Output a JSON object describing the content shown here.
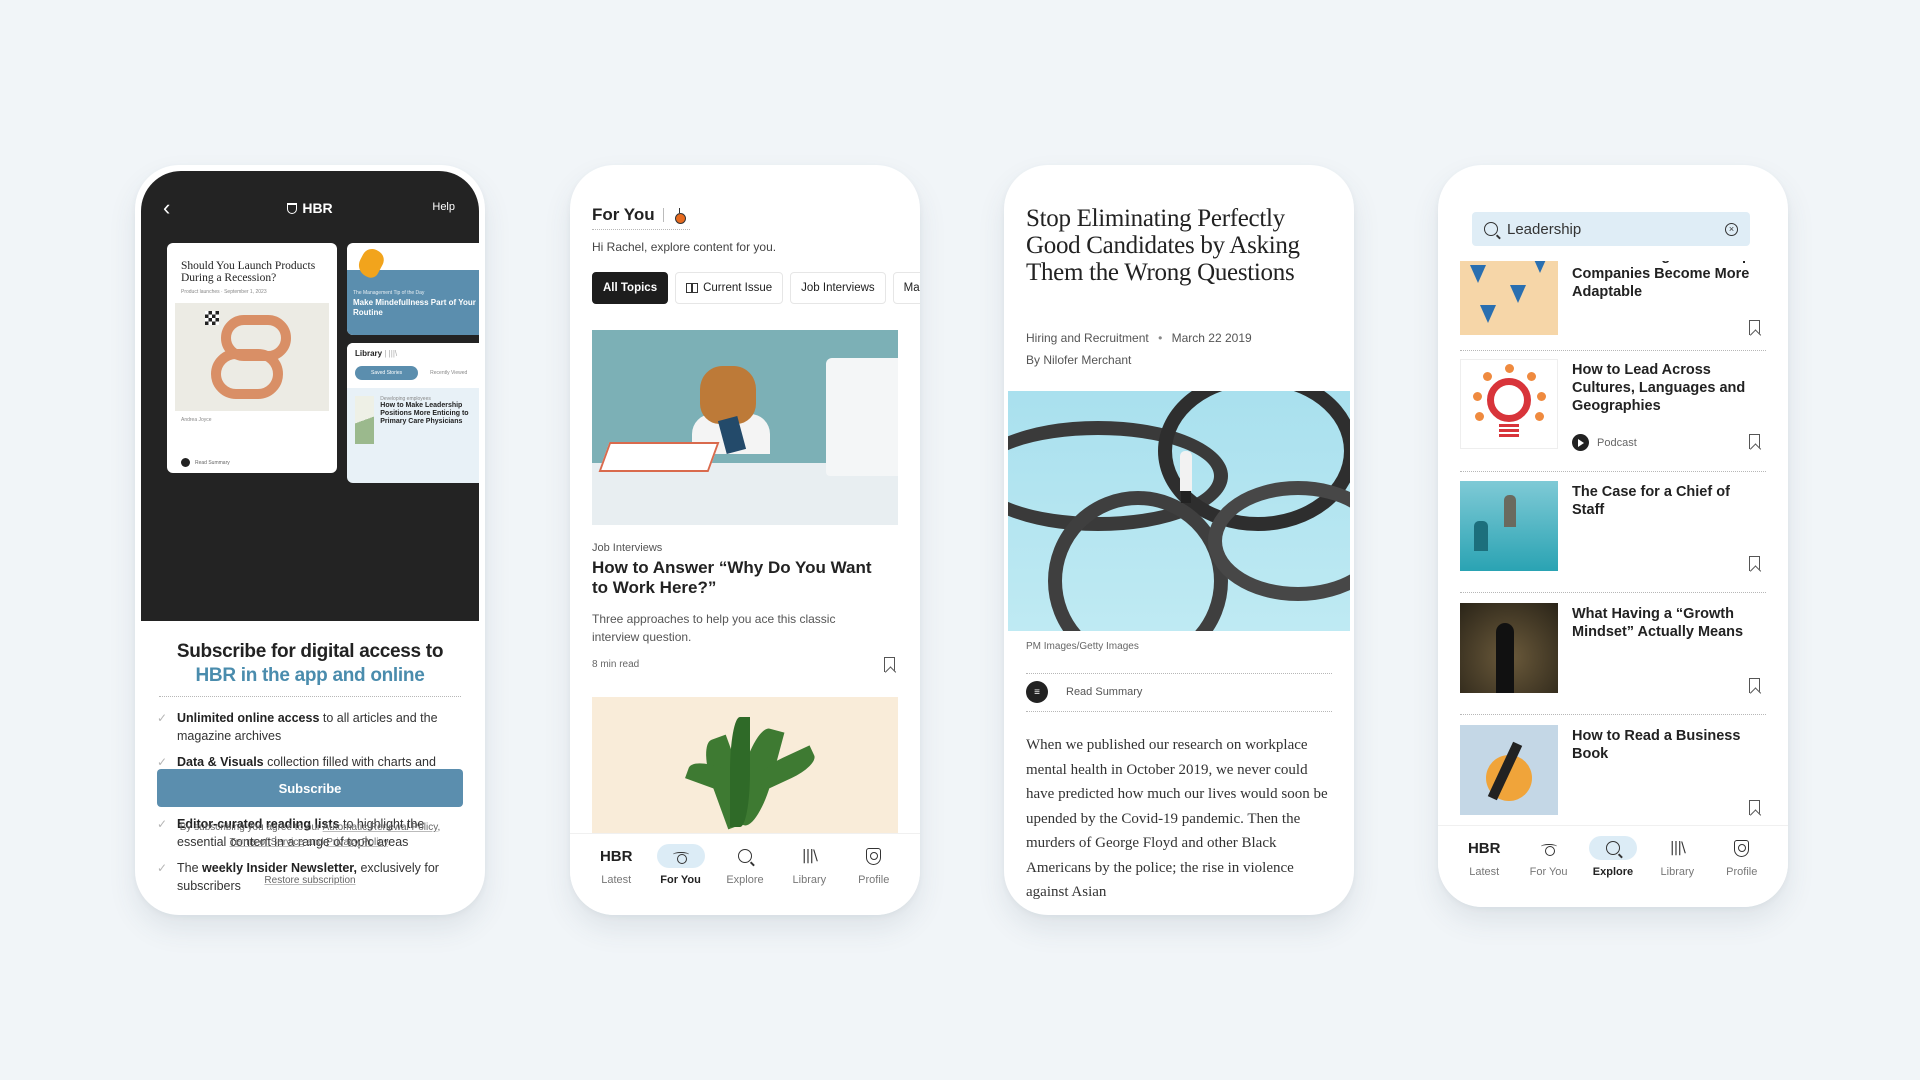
{
  "colors": {
    "background": "#f1f5f8",
    "accent": "#5b8eae",
    "accent_text": "#4a8cad",
    "dark": "#232323",
    "search_bg": "#dfedf6",
    "active_nav_bg": "#dcecf6"
  },
  "phones": [
    {
      "id": "subscribe-screen",
      "header": {
        "back_icon": "chevron-left-icon",
        "logo": "HBR",
        "help_label": "Help"
      },
      "preview": {
        "article": {
          "title": "Should You Launch Products During a Recession?",
          "meta": "Product launches · September 1, 2023",
          "credit": "Andrea Joyce",
          "read_summary": "Read Summary"
        },
        "tip": {
          "kicker": "The Management Tip of the Day",
          "title": "Make Mindefullness Part of Your Routine"
        },
        "library": {
          "title": "Library",
          "tabs": [
            "Saved Stories",
            "Recently Viewed"
          ],
          "item_category": "Developing employees",
          "item_title": "How to Make Leadership Positions More Enticing to Primary Care Physicians"
        }
      },
      "headline": "Subscribe for digital access to",
      "headline_accent": "HBR in the app and online",
      "features": [
        {
          "bold": "Unlimited online access",
          "rest": " to all articles and the magazine archives",
          "prefix": ""
        },
        {
          "bold": "Data & Visuals",
          "rest": " collection filled with charts and infographics for sparking engaging discussions with your teams",
          "prefix": ""
        },
        {
          "bold": "Editor-curated reading lists",
          "rest": " to highlight the essential content in a range of topic areas",
          "prefix": ""
        },
        {
          "prefix": "The ",
          "bold": "weekly Insider Newsletter,",
          "rest": " exclusively for subscribers"
        }
      ],
      "subscribe_label": "Subscribe",
      "legal": {
        "prefix": "By subscribing you agree to our ",
        "link1": "Automatic Renewal Policy",
        "sep": ", ",
        "link2": "Terms of Service",
        "and": " and ",
        "link3": "Privacy Policy",
        "end": "."
      },
      "restore_label": "Restore subscription"
    },
    {
      "id": "for-you-screen",
      "title": "For You",
      "greeting": "Hi Rachel, explore content for you.",
      "chips": [
        "All Topics",
        "Current Issue",
        "Job Interviews",
        "Management"
      ],
      "article": {
        "category": "Job Interviews",
        "title": "How to Answer “Why Do You Want to Work Here?”",
        "description": "Three approaches to help you ace this classic interview question.",
        "read_time": "8 min read"
      }
    },
    {
      "id": "article-screen",
      "title": "Stop Eliminating Perfectly Good Candidates by Asking Them the Wrong Questions",
      "topic": "Hiring and Recruitment",
      "date": "March 22 2019",
      "author": "By Nilofer Merchant",
      "image_credit": "PM Images/Getty Images",
      "read_summary": "Read Summary",
      "body": "When we published our research on workplace mental health in October 2019, we never could have predicted how much our lives would soon be upended by the Covid-19 pandemic. Then the murders of George Floyd and other Black Americans by the police; the rise in violence against Asian"
    },
    {
      "id": "explore-screen",
      "search": {
        "value": "Leadership",
        "placeholder": "Search"
      },
      "results": [
        {
          "title": "How Investing in DEI Helps Companies Become More Adaptable",
          "type": ""
        },
        {
          "title": "How to Lead Across Cultures, Languages and Geographies",
          "type": "Podcast"
        },
        {
          "title": "The Case for a Chief of Staff",
          "type": ""
        },
        {
          "title": "What Having a “Growth Mindset” Actually Means",
          "type": ""
        },
        {
          "title": "How to Read a Business Book",
          "type": ""
        }
      ]
    }
  ],
  "nav": {
    "items": [
      {
        "label": "Latest",
        "icon": "hbr-logo-icon",
        "mark": "HBR"
      },
      {
        "label": "For You",
        "icon": "for-you-icon"
      },
      {
        "label": "Explore",
        "icon": "search-icon"
      },
      {
        "label": "Library",
        "icon": "library-icon",
        "glyph": "|||\\"
      },
      {
        "label": "Profile",
        "icon": "profile-shield-icon"
      }
    ],
    "active_phone2": "For You",
    "active_phone4": "Explore"
  }
}
